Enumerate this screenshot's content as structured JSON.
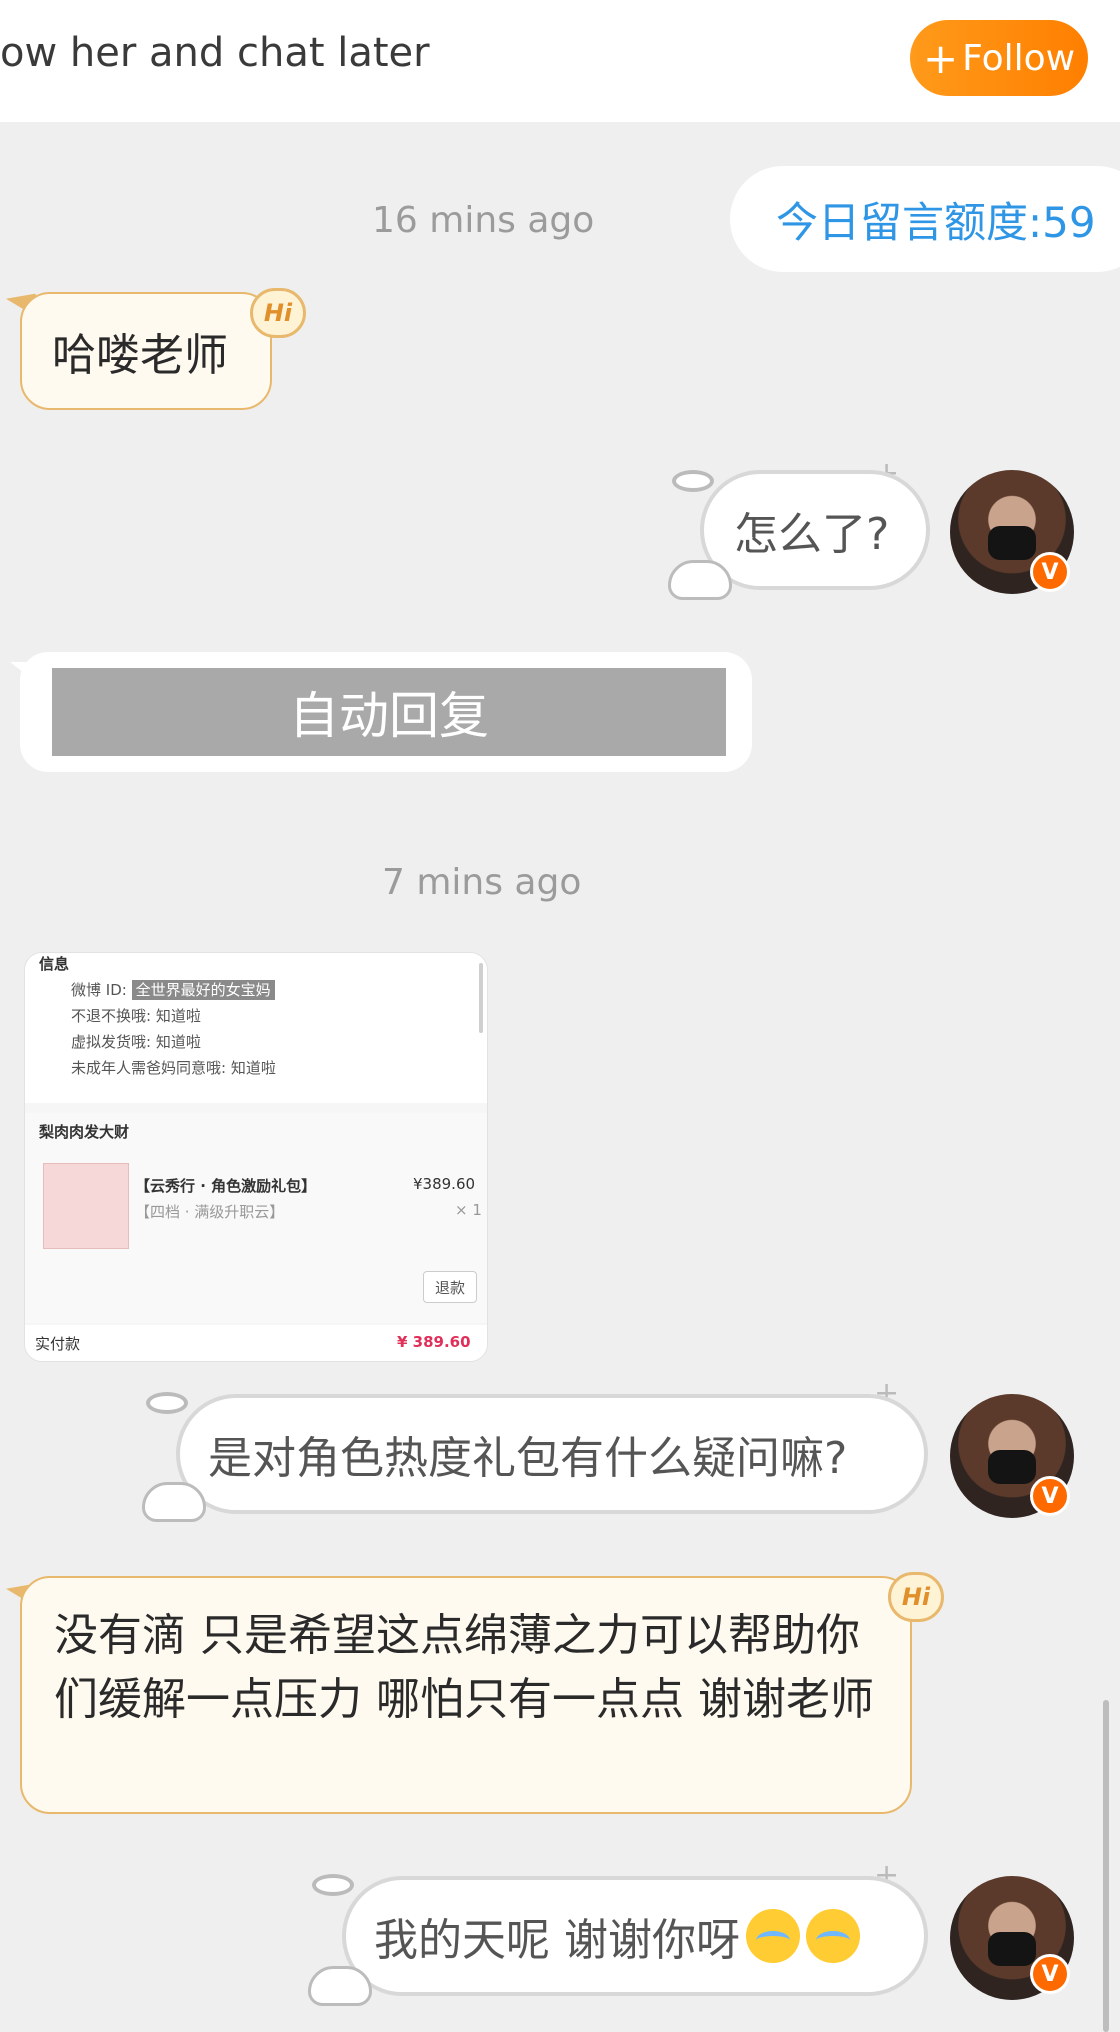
{
  "header": {
    "text": "ow her and chat later",
    "follow_label": "Follow",
    "follow_icon": "plus-icon"
  },
  "quota": {
    "label": "今日留言额度:59"
  },
  "timestamps": [
    "16 mins ago",
    "7 mins ago"
  ],
  "messages": {
    "in_1": "哈喽老师",
    "out_1": "怎么了?",
    "auto_reply": "自动回复",
    "out_2": "是对角色热度礼包有什么疑问嘛?",
    "in_2": "没有滴 只是希望这点绵薄之力可以帮助你们缓解一点压力 哪怕只有一点点 谢谢老师",
    "out_3": "我的天呢 谢谢你呀"
  },
  "badges": {
    "hi": "Hi",
    "verified": "V"
  },
  "screenshot": {
    "section_title": "信息",
    "weibo_id_label": "微博 ID:",
    "weibo_id_value": "全世界最好的女宝妈",
    "line2": "不退不换哦: 知道啦",
    "line3": "虚拟发货哦: 知道啦",
    "line4": "未成年人需爸妈同意哦: 知道啦",
    "shop_name": "梨肉肉发大财",
    "product_title": "【云秀行 · 角色激励礼包】",
    "product_sub": "【四档 · 满级升职云】",
    "price": "¥389.60",
    "qty": "× 1",
    "refund_label": "退款",
    "paid_label": "实付款",
    "paid_value": "¥ 389.60"
  },
  "colors": {
    "accent_orange": "#ff8a00",
    "quota_blue": "#2f96e6",
    "bubble_in_bg": "#fffaf0",
    "bubble_in_border": "#e8b86c",
    "background": "#efefef"
  }
}
